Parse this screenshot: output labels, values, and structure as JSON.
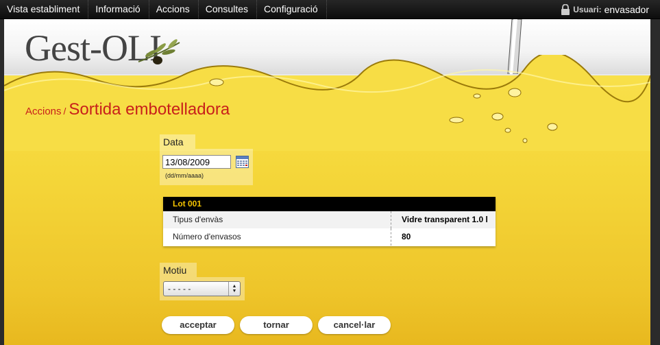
{
  "nav": {
    "items": [
      {
        "label": "Vista establiment"
      },
      {
        "label": "Informació"
      },
      {
        "label": "Accions"
      },
      {
        "label": "Consultes"
      },
      {
        "label": "Configuració"
      }
    ],
    "user_label": "Usuari:",
    "user_name": "envasador"
  },
  "logo": {
    "text": "Gest-OLI"
  },
  "breadcrumb": {
    "parent": "Accions",
    "separator": "/",
    "title": "Sortida embotelladora"
  },
  "date": {
    "label": "Data",
    "value": "13/08/2009",
    "hint": "(dd/mm/aaaa)"
  },
  "lot": {
    "title": "Lot 001",
    "rows": [
      {
        "key": "Tipus d'envàs",
        "value": "Vidre transparent 1.0 l"
      },
      {
        "key": "Número d'envasos",
        "value": "80"
      }
    ]
  },
  "motiu": {
    "label": "Motiu",
    "selected": "- - - - -"
  },
  "buttons": {
    "accept": "acceptar",
    "back": "tornar",
    "cancel": "cancel·lar"
  },
  "colors": {
    "accent_red": "#c8201b",
    "oil_yellow": "#f5d73a",
    "lot_header_text": "#f5c400"
  }
}
